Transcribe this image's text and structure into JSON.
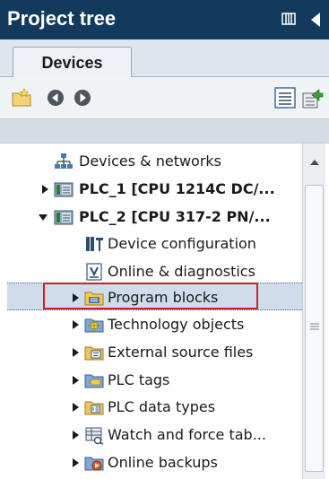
{
  "panel": {
    "title": "Project tree",
    "tab_label": "Devices"
  },
  "colors": {
    "title_bg": "#123a5c",
    "selection_bg": "#cfdceb",
    "highlight_border": "#d11f2a"
  },
  "toolbar": {
    "icons": [
      "new-folder-icon",
      "back-icon",
      "forward-icon",
      "overview-icon",
      "export-icon"
    ]
  },
  "tree": {
    "items": [
      {
        "label": "Devices & networks",
        "icon": "network-icon",
        "expander": "none"
      },
      {
        "label": "PLC_1 [CPU 1214C DC/...",
        "icon": "plc-icon",
        "expander": "collapsed"
      },
      {
        "label": "PLC_2 [CPU 317-2 PN/...",
        "icon": "plc-icon",
        "expander": "expanded"
      },
      {
        "label": "Device configuration",
        "icon": "device-config-icon",
        "expander": "none"
      },
      {
        "label": "Online & diagnostics",
        "icon": "online-diagnostics-icon",
        "expander": "none"
      },
      {
        "label": "Program blocks",
        "icon": "program-blocks-icon",
        "expander": "collapsed",
        "selected": true,
        "highlighted": true
      },
      {
        "label": "Technology objects",
        "icon": "technology-objects-icon",
        "expander": "collapsed"
      },
      {
        "label": "External source files",
        "icon": "external-source-icon",
        "expander": "collapsed"
      },
      {
        "label": "PLC tags",
        "icon": "plc-tags-icon",
        "expander": "collapsed"
      },
      {
        "label": "PLC data types",
        "icon": "plc-data-types-icon",
        "expander": "collapsed"
      },
      {
        "label": "Watch and force tab...",
        "icon": "watch-table-icon",
        "expander": "collapsed"
      },
      {
        "label": "Online backups",
        "icon": "online-backups-icon",
        "expander": "collapsed"
      }
    ]
  }
}
